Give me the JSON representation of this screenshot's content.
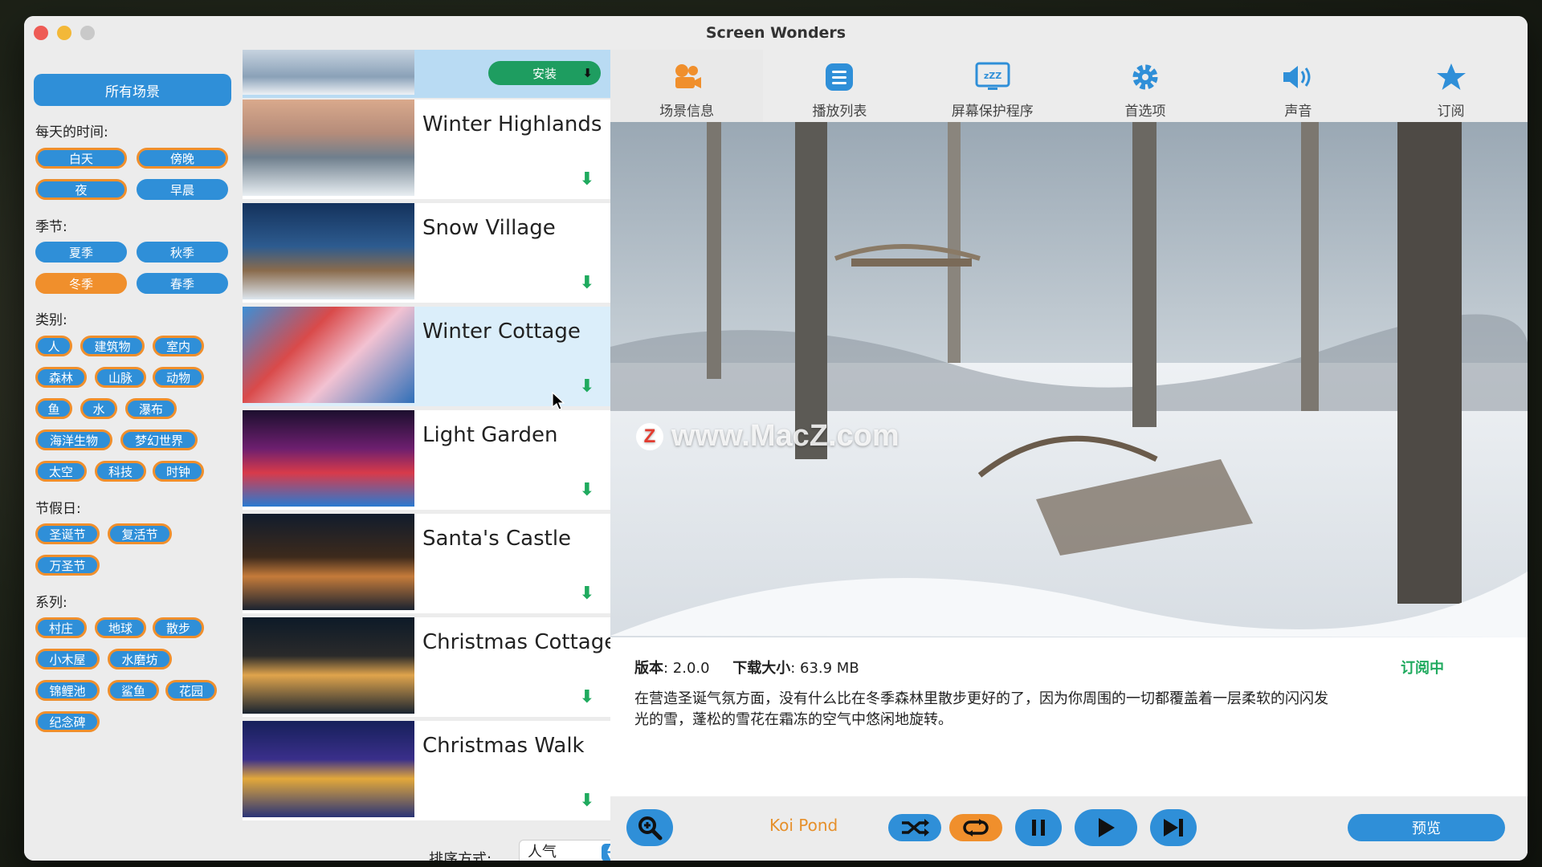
{
  "window": {
    "title": "Screen Wonders"
  },
  "sidebar": {
    "all_scenes": "所有场景",
    "sections": {
      "time": {
        "title": "每天的时间:",
        "tags": [
          "白天",
          "傍晚",
          "夜",
          "早晨"
        ]
      },
      "season": {
        "title": "季节:",
        "tags": [
          "夏季",
          "秋季",
          "冬季",
          "春季"
        ],
        "selected": "冬季"
      },
      "category": {
        "title": "类别:",
        "tags": [
          "人",
          "建筑物",
          "室内",
          "森林",
          "山脉",
          "动物",
          "鱼",
          "水",
          "瀑布",
          "海洋生物",
          "梦幻世界",
          "太空",
          "科技",
          "时钟"
        ]
      },
      "holiday": {
        "title": "节假日:",
        "tags": [
          "圣诞节",
          "复活节",
          "万圣节"
        ]
      },
      "series": {
        "title": "系列:",
        "tags": [
          "村庄",
          "地球",
          "散步",
          "小木屋",
          "水磨坊",
          "锦鲤池",
          "鲨鱼",
          "花园",
          "纪念碑"
        ]
      }
    }
  },
  "scene_list": {
    "install_label": "安装",
    "items": [
      {
        "title": "Winter Highlands"
      },
      {
        "title": "Snow Village"
      },
      {
        "title": "Winter Cottage"
      },
      {
        "title": "Light Garden"
      },
      {
        "title": "Santa's Castle"
      },
      {
        "title": "Christmas Cottage"
      },
      {
        "title": "Christmas Walk"
      }
    ],
    "selected_index": 2,
    "sort_label": "排序方式:",
    "sort_value": "人气"
  },
  "tabs": [
    {
      "label": "场景信息",
      "icon": "camera-icon"
    },
    {
      "label": "播放列表",
      "icon": "list-icon"
    },
    {
      "label": "屏幕保护程序",
      "icon": "screensaver-icon"
    },
    {
      "label": "首选项",
      "icon": "gear-icon"
    },
    {
      "label": "声音",
      "icon": "speaker-icon"
    },
    {
      "label": "订阅",
      "icon": "star-icon"
    }
  ],
  "preview": {
    "watermark_logo": "Z",
    "watermark_text": "www.MacZ.com"
  },
  "info": {
    "version_label": "版本",
    "version_value": ": 2.0.0",
    "size_label": "下载大小",
    "size_value": ": 63.9 MB",
    "status": "订阅中",
    "description": "在营造圣诞气氛方面，没有什么比在冬季森林里散步更好的了，因为你周围的一切都覆盖着一层柔软的闪闪发光的雪，蓬松的雪花在霜冻的空气中悠闲地旋转。"
  },
  "controls": {
    "now_playing": "Koi Pond",
    "preview_label": "预览"
  },
  "colors": {
    "accent": "#2f8fd8",
    "orange": "#f08f2c",
    "green": "#1faa5e"
  }
}
